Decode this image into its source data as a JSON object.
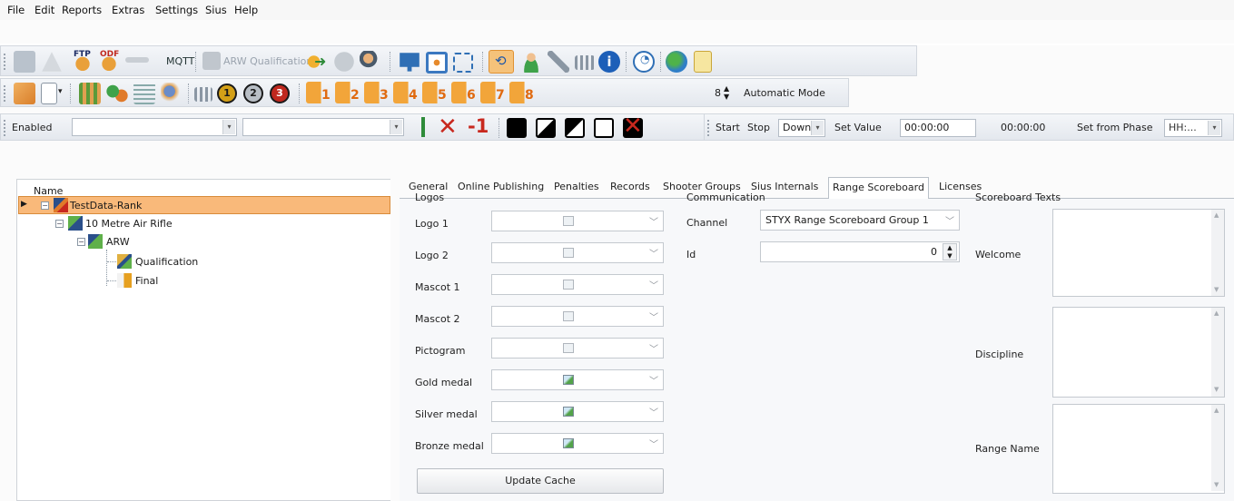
{
  "menu": [
    "File",
    "Edit",
    "Reports",
    "Extras",
    "Settings",
    "Sius",
    "Help"
  ],
  "toolbar1": {
    "mqtt_label": "MQTT",
    "arw_label": "ARW Qualification"
  },
  "toolbar2": {
    "lane_numbers": [
      "1",
      "2",
      "3",
      "4",
      "5",
      "6",
      "7",
      "8"
    ],
    "spinner_value": "8",
    "mode_label": "Automatic Mode"
  },
  "toolbar3": {
    "filter_value": "Enabled",
    "minus_one": "-1",
    "start_label": "Start",
    "stop_label": "Stop",
    "direction_value": "Down",
    "set_value_label": "Set Value",
    "time_input": "00:00:00",
    "time_readout": "00:00:00",
    "set_from_phase_label": "Set from Phase",
    "phase_placeholder": "HH:..."
  },
  "tree": {
    "header": "Name",
    "items": [
      {
        "label": "TestData-Rank",
        "level": 0
      },
      {
        "label": "10 Metre Air Rifle",
        "level": 1
      },
      {
        "label": "ARW",
        "level": 2
      },
      {
        "label": "Qualification",
        "level": 3
      },
      {
        "label": "Final",
        "level": 3
      }
    ]
  },
  "tabs": [
    "General",
    "Online Publishing",
    "Penalties",
    "Records",
    "Shooter Groups",
    "Sius Internals",
    "Range Scoreboard",
    "Licenses"
  ],
  "logos": {
    "title": "Logos",
    "items": [
      "Logo 1",
      "Logo 2",
      "Mascot 1",
      "Mascot 2",
      "Pictogram",
      "Gold medal",
      "Silver medal",
      "Bronze medal"
    ],
    "update_button": "Update Cache"
  },
  "communication": {
    "title": "Communication",
    "channel_label": "Channel",
    "channel_value": "STYX Range Scoreboard Group 1",
    "id_label": "Id",
    "id_value": "0"
  },
  "scoreboard_texts": {
    "title": "Scoreboard Texts",
    "fields": [
      "Welcome",
      "Discipline",
      "Range Name"
    ]
  },
  "colors": {
    "selection": "#f9b97a",
    "accent_orange": "#f0902a",
    "medal_red": "#c0281e"
  }
}
